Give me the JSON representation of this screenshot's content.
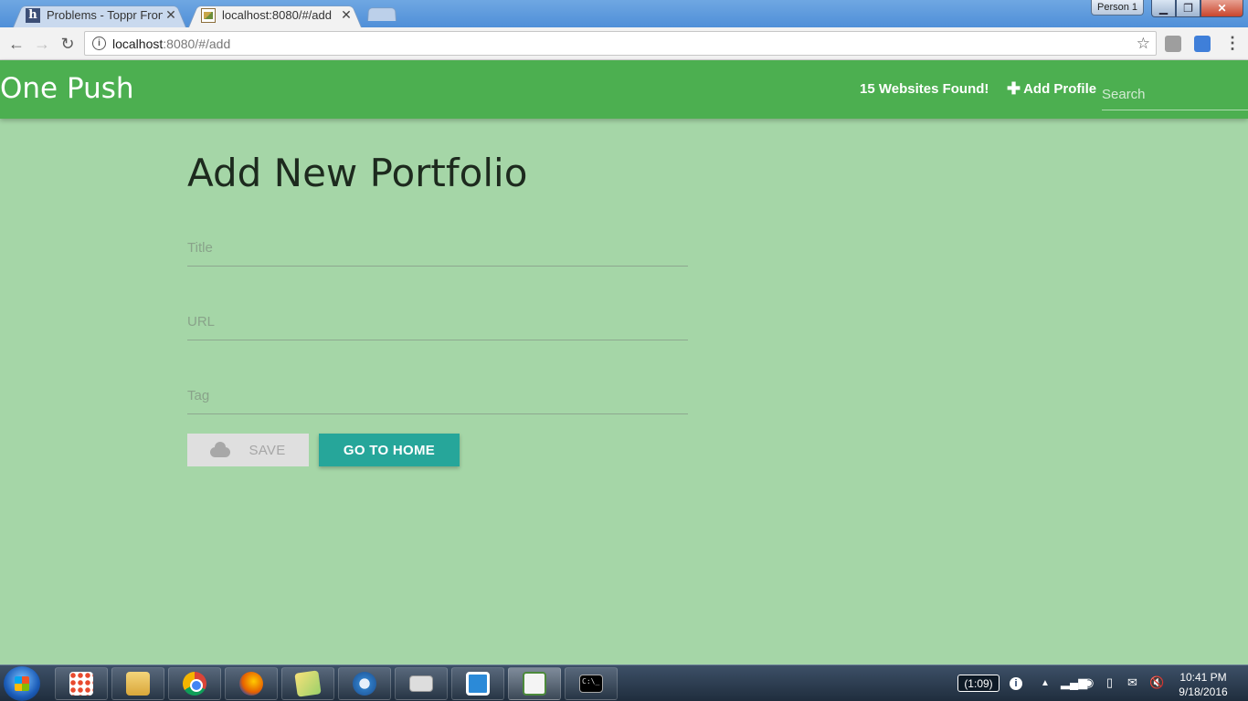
{
  "browser": {
    "tabs": [
      {
        "title": "Problems - Toppr Fronte",
        "favicon": "h-letter-icon"
      },
      {
        "title": "localhost:8080/#/add",
        "favicon": "image-icon"
      }
    ],
    "profile_label": "Person 1",
    "address": {
      "host": "localhost",
      "path": ":8080/#/add"
    }
  },
  "app": {
    "brand": "One Push",
    "found_text": "15 Websites Found!",
    "add_profile_label": "Add Profile",
    "search_placeholder": "Search"
  },
  "form": {
    "heading": "Add New Portfolio",
    "title_placeholder": "Title",
    "url_placeholder": "URL",
    "tag_placeholder": "Tag",
    "save_label": "SAVE",
    "home_label": "GO TO HOME"
  },
  "taskbar": {
    "apps": [
      "apps-grid-icon",
      "file-explorer-icon",
      "chrome-icon",
      "firefox-icon",
      "sticky-notes-icon",
      "network-icon",
      "mail-icon",
      "bracket-app-icon",
      "chart-app-icon",
      "command-prompt-icon"
    ],
    "battery": "(1:09)",
    "time": "10:41 PM",
    "date": "9/18/2016"
  },
  "colors": {
    "navbar": "#4caf50",
    "page_background": "#a5d6a7",
    "home_button": "#26a69a",
    "save_button": "#dfdfdf"
  }
}
